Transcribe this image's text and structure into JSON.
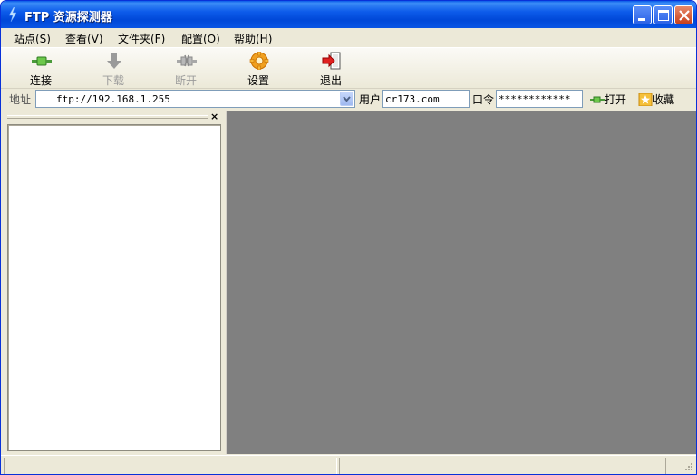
{
  "window": {
    "title": "FTP 资源探测器",
    "app_icon": "lightning-icon"
  },
  "menu": {
    "items": [
      {
        "label": "站点(S)"
      },
      {
        "label": "查看(V)"
      },
      {
        "label": "文件夹(F)"
      },
      {
        "label": "配置(O)"
      },
      {
        "label": "帮助(H)"
      }
    ]
  },
  "toolbar": {
    "connect": {
      "label": "连接",
      "icon": "plug-connect-icon",
      "enabled": true
    },
    "download": {
      "label": "下载",
      "icon": "download-arrow-icon",
      "enabled": false
    },
    "disconnect": {
      "label": "断开",
      "icon": "plug-disconnect-icon",
      "enabled": false
    },
    "settings": {
      "label": "设置",
      "icon": "gear-icon",
      "enabled": true
    },
    "exit": {
      "label": "退出",
      "icon": "exit-door-icon",
      "enabled": true
    }
  },
  "address": {
    "label": "地址",
    "value": "ftp://192.168.1.255",
    "user_label": "用户",
    "user_value": "cr173.com",
    "password_label": "口令",
    "password_value": "************",
    "open_label": "打开",
    "favorite_label": "收藏"
  },
  "panel": {
    "close_glyph": "×"
  },
  "colors": {
    "titlebar": "#0054e3",
    "window_face": "#ece9d8",
    "main_area": "#808080"
  }
}
